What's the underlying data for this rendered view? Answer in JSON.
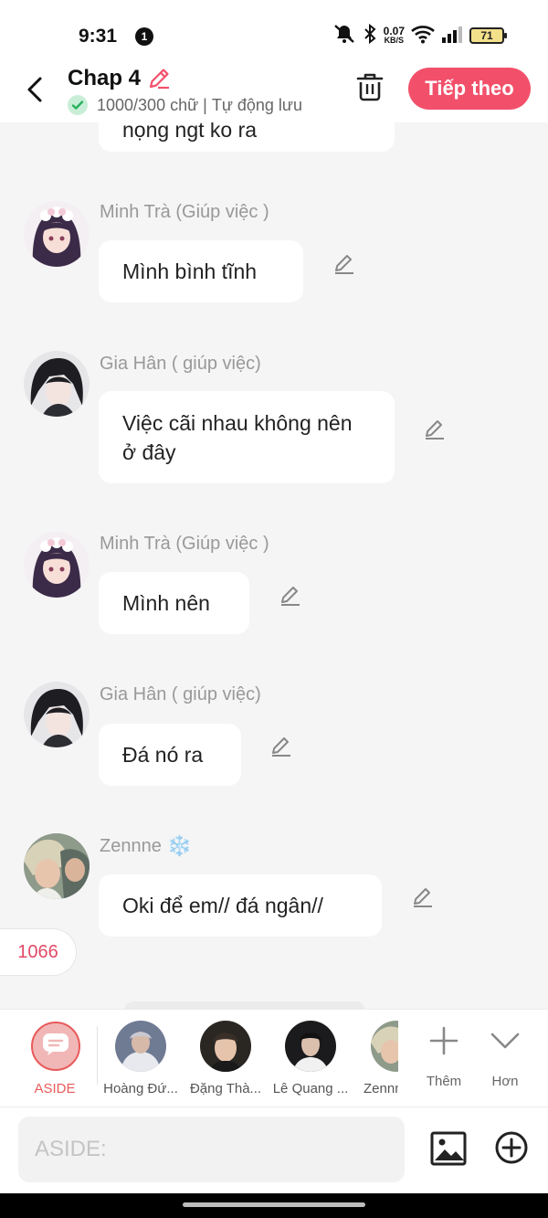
{
  "status_bar": {
    "time": "9:31",
    "notification_count": "1",
    "net_speed": "0.07",
    "net_unit": "KB/S",
    "battery": "71"
  },
  "header": {
    "title": "Chap 4",
    "word_count": "1000/300 chữ",
    "separator": "|",
    "autosave": "Tự động lưu",
    "next_label": "Tiếp theo"
  },
  "chat": {
    "partial_text": "nọng ngt ko ra",
    "messages": [
      {
        "sender": "Minh Trà (Giúp việc )",
        "text": "Mình bình tĩnh",
        "avatar": "maid-girl-avatar"
      },
      {
        "sender": "Gia Hân ( giúp việc)",
        "text": "Việc cãi nhau không nên ở đây",
        "avatar": "dark-hair-avatar"
      },
      {
        "sender": "Minh Trà (Giúp việc )",
        "text": "Mình nên",
        "avatar": "maid-girl-avatar"
      },
      {
        "sender": "Gia Hân ( giúp việc)",
        "text": "Đá nó ra",
        "avatar": "dark-hair-avatar"
      },
      {
        "sender": "Zennne",
        "sender_badge": "❄️",
        "text": "Oki để em// đá ngân//",
        "avatar": "photo-avatar"
      }
    ],
    "counter": "1066"
  },
  "characters": [
    {
      "name": "ASIDE"
    },
    {
      "name": "Hoàng Đứ..."
    },
    {
      "name": "Đặng Thà..."
    },
    {
      "name": "Lê Quang ..."
    },
    {
      "name": "Zennn"
    }
  ],
  "toolbar": {
    "add_label": "Thêm",
    "more_label": "Hơn"
  },
  "input": {
    "placeholder": "ASIDE:"
  },
  "colors": {
    "accent": "#f2506a",
    "background": "#f5f5f5"
  }
}
